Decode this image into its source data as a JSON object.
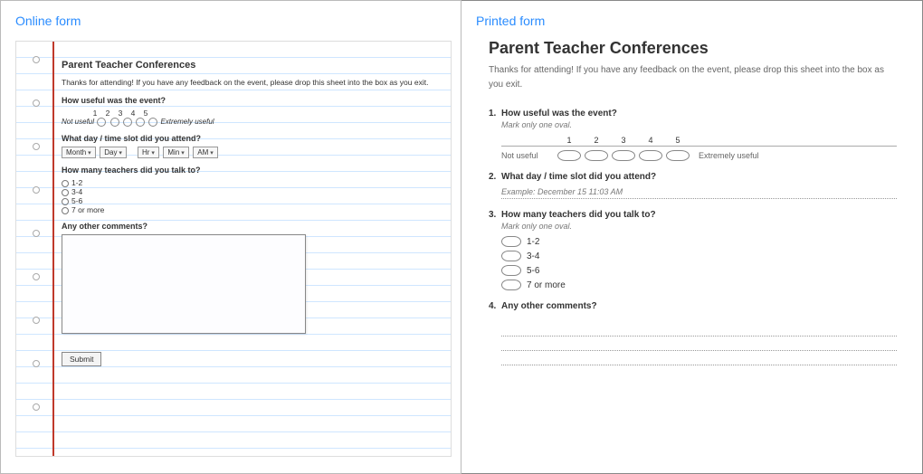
{
  "left": {
    "paneTitle": "Online form",
    "title": "Parent Teacher Conferences",
    "desc": "Thanks for attending! If you have any feedback on the event, please drop this sheet into the box as you exit.",
    "q1": {
      "label": "How useful was the event?",
      "nums": [
        "1",
        "2",
        "3",
        "4",
        "5"
      ],
      "lowLabel": "Not useful",
      "highLabel": "Extremely useful"
    },
    "q2": {
      "label": "What day / time slot did you attend?",
      "selects": [
        "Month",
        "Day",
        "Hr",
        "Min",
        "AM"
      ]
    },
    "q3": {
      "label": "How many teachers did you talk to?",
      "opts": [
        "1-2",
        "3-4",
        "5-6",
        "7 or more"
      ]
    },
    "q4": {
      "label": "Any other comments?"
    },
    "submit": "Submit"
  },
  "right": {
    "paneTitle": "Printed form",
    "title": "Parent Teacher Conferences",
    "desc": "Thanks for attending! If you have any feedback on the event, please drop this sheet into the box as you exit.",
    "q1": {
      "num": "1.",
      "label": "How useful was the event?",
      "hint": "Mark only one oval.",
      "nums": [
        "1",
        "2",
        "3",
        "4",
        "5"
      ],
      "lowLabel": "Not useful",
      "highLabel": "Extremely useful"
    },
    "q2": {
      "num": "2.",
      "label": "What day / time slot did you attend?",
      "example": "Example: December 15 11:03 AM"
    },
    "q3": {
      "num": "3.",
      "label": "How many teachers did you talk to?",
      "hint": "Mark only one oval.",
      "opts": [
        "1-2",
        "3-4",
        "5-6",
        "7 or more"
      ]
    },
    "q4": {
      "num": "4.",
      "label": "Any other comments?"
    }
  }
}
